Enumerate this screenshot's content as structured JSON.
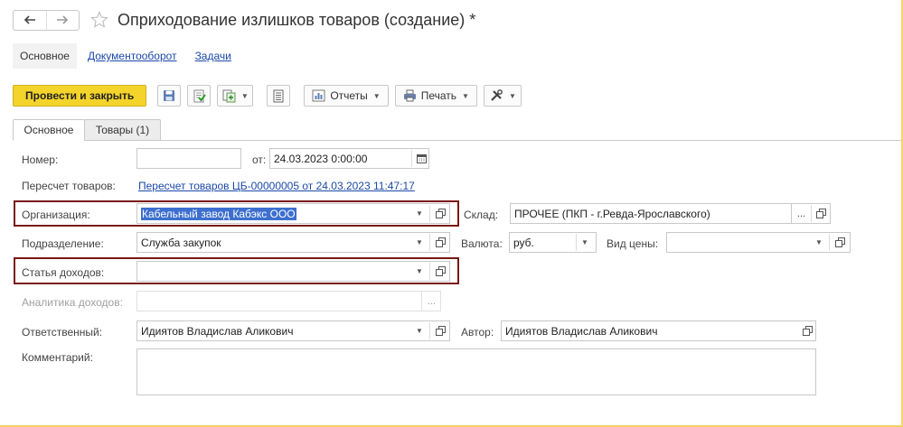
{
  "window": {
    "title": "Оприходование излишков товаров (создание) *"
  },
  "sections": {
    "main": "Основное",
    "docflow": "Документооборот",
    "tasks": "Задачи"
  },
  "toolbar": {
    "post_close": "Провести и закрыть",
    "reports": "Отчеты",
    "print": "Печать"
  },
  "form_tabs": {
    "main": "Основное",
    "goods": "Товары (1)"
  },
  "form": {
    "number_label": "Номер:",
    "number_value": "",
    "date_label": "от:",
    "date_value": "24.03.2023  0:00:00",
    "recount_label": "Пересчет товаров:",
    "recount_link": "Пересчет товаров ЦБ-00000005 от 24.03.2023 11:47:17",
    "org_label": "Организация:",
    "org_value": "Кабельный завод Кабэкс ООО",
    "warehouse_label": "Склад:",
    "warehouse_value": "ПРОЧЕЕ (ПКП - г.Ревда-Ярославского)",
    "division_label": "Подразделение:",
    "division_value": "Служба закупок",
    "currency_label": "Валюта:",
    "currency_value": "руб.",
    "price_type_label": "Вид цены:",
    "price_type_value": "",
    "income_item_label": "Статья доходов:",
    "income_item_value": "",
    "income_analytics_label": "Аналитика доходов:",
    "income_analytics_value": "",
    "responsible_label": "Ответственный:",
    "responsible_value": "Идиятов Владислав Аликович",
    "author_label": "Автор:",
    "author_value": "Идиятов Владислав Аликович",
    "comment_label": "Комментарий:",
    "comment_value": ""
  },
  "colors": {
    "primary": "#f4d42a",
    "link": "#1c49a8",
    "highlight": "#7a1717",
    "selection": "#3d6fce"
  }
}
